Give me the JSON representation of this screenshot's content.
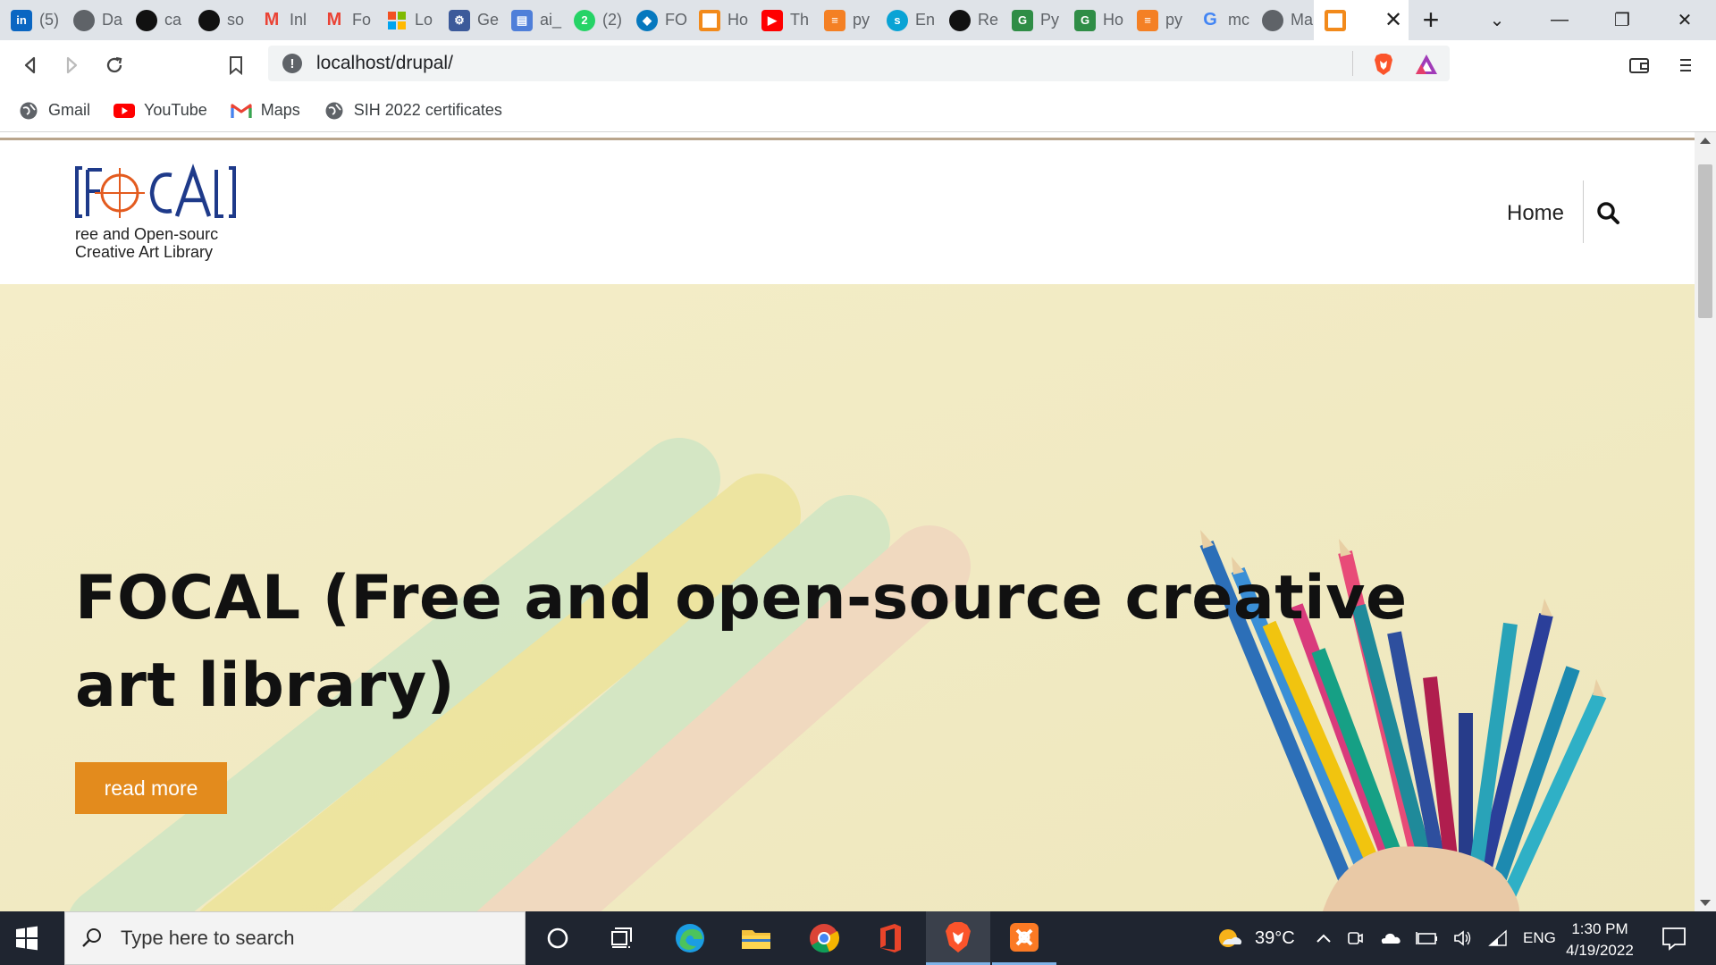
{
  "browser": {
    "tabs": [
      {
        "label": "(5)",
        "icon": "linkedin-icon",
        "color": "#0a66c2",
        "glyph": "in"
      },
      {
        "label": "Da",
        "icon": "globe-icon",
        "color": "#5f6368",
        "glyph": ""
      },
      {
        "label": "ca",
        "icon": "github-icon",
        "color": "#111111",
        "glyph": ""
      },
      {
        "label": "so",
        "icon": "github-icon",
        "color": "#111111",
        "glyph": ""
      },
      {
        "label": "Inl",
        "icon": "gmail-icon",
        "color": "#ffffff",
        "glyph": "M"
      },
      {
        "label": "Fo",
        "icon": "gmail-icon",
        "color": "#ffffff",
        "glyph": "M"
      },
      {
        "label": "Lo",
        "icon": "microsoft-icon",
        "color": "#ffffff",
        "glyph": ""
      },
      {
        "label": "Ge",
        "icon": "gear-icon",
        "color": "#3c5a9a",
        "glyph": "⚙"
      },
      {
        "label": "ai_",
        "icon": "table-icon",
        "color": "#4f7fd9",
        "glyph": "▤"
      },
      {
        "label": "(2)",
        "icon": "whatsapp-icon",
        "color": "#25d366",
        "glyph": "2"
      },
      {
        "label": "FO",
        "icon": "drupal-icon",
        "color": "#0678be",
        "glyph": "◆"
      },
      {
        "label": "Ho",
        "icon": "xampp-icon",
        "color": "#f28a1b",
        "glyph": "□"
      },
      {
        "label": "Th",
        "icon": "youtube-icon",
        "color": "#ff0000",
        "glyph": "▶"
      },
      {
        "label": "py",
        "icon": "stackoverflow-icon",
        "color": "#f48024",
        "glyph": "≡"
      },
      {
        "label": "En",
        "icon": "spacy-icon",
        "color": "#09a3d5",
        "glyph": "s"
      },
      {
        "label": "Re",
        "icon": "github-icon",
        "color": "#111111",
        "glyph": ""
      },
      {
        "label": "Py",
        "icon": "geeks-icon",
        "color": "#2f8d46",
        "glyph": "G"
      },
      {
        "label": "Ho",
        "icon": "geeks-icon",
        "color": "#2f8d46",
        "glyph": "G"
      },
      {
        "label": "py",
        "icon": "stackoverflow-icon",
        "color": "#f48024",
        "glyph": "≡"
      },
      {
        "label": "mc",
        "icon": "google-icon",
        "color": "#ffffff",
        "glyph": "G"
      },
      {
        "label": "Ma",
        "icon": "globe-icon",
        "color": "#5f6368",
        "glyph": ""
      },
      {
        "label": "",
        "icon": "xampp-icon",
        "color": "#f28a1b",
        "glyph": "□",
        "active": true
      }
    ],
    "address": "localhost/drupal/",
    "bookmarks": [
      {
        "label": "Gmail",
        "icon": "globe-icon"
      },
      {
        "label": "YouTube",
        "icon": "youtube-icon"
      },
      {
        "label": "Maps",
        "icon": "gmail-icon"
      },
      {
        "label": "SIH 2022 certificates",
        "icon": "globe-icon"
      }
    ]
  },
  "site": {
    "logo": {
      "mark": "[FOCAL]",
      "line1": "ree and Open-sourc",
      "line2": "Creative Art Library"
    },
    "nav": {
      "home": "Home"
    },
    "hero": {
      "title": "FOCAL (Free and open-source creative art library)",
      "button": "read more"
    }
  },
  "taskbar": {
    "search_placeholder": "Type here to search",
    "weather": "39°C",
    "language": "ENG",
    "time": "1:30 PM",
    "date": "4/19/2022"
  },
  "colors": {
    "accent": "#e38b1d",
    "hero_bg": "#f3edc6",
    "taskbar": "#1f2530"
  }
}
